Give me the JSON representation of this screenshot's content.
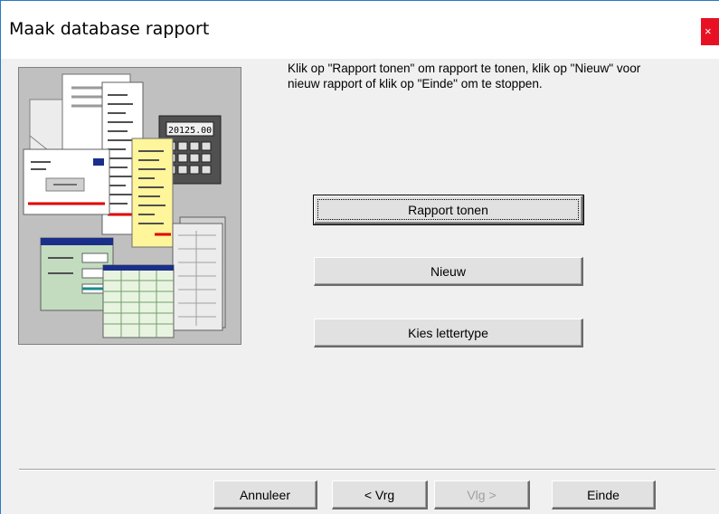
{
  "window": {
    "title": "Maak database rapport",
    "close_glyph": "×"
  },
  "instruction_text": "Klik op \"Rapport tonen\" om rapport te tonen, klik op \"Nieuw\" voor nieuw rapport of klik op \"Einde\" om te stoppen.",
  "illustration": {
    "calculator_display": "20125.00"
  },
  "buttons": {
    "show_report": "Rapport tonen",
    "new": "Nieuw",
    "choose_font": "Kies lettertype"
  },
  "footer": {
    "cancel": "Annuleer",
    "previous": "< Vrg",
    "next": "Vlg >",
    "finish": "Einde"
  },
  "colors": {
    "title_bar": "#ffffff",
    "close_button": "#e81123",
    "dialog_background": "#f0f0f0",
    "illustration_background": "#c0c0c0"
  }
}
